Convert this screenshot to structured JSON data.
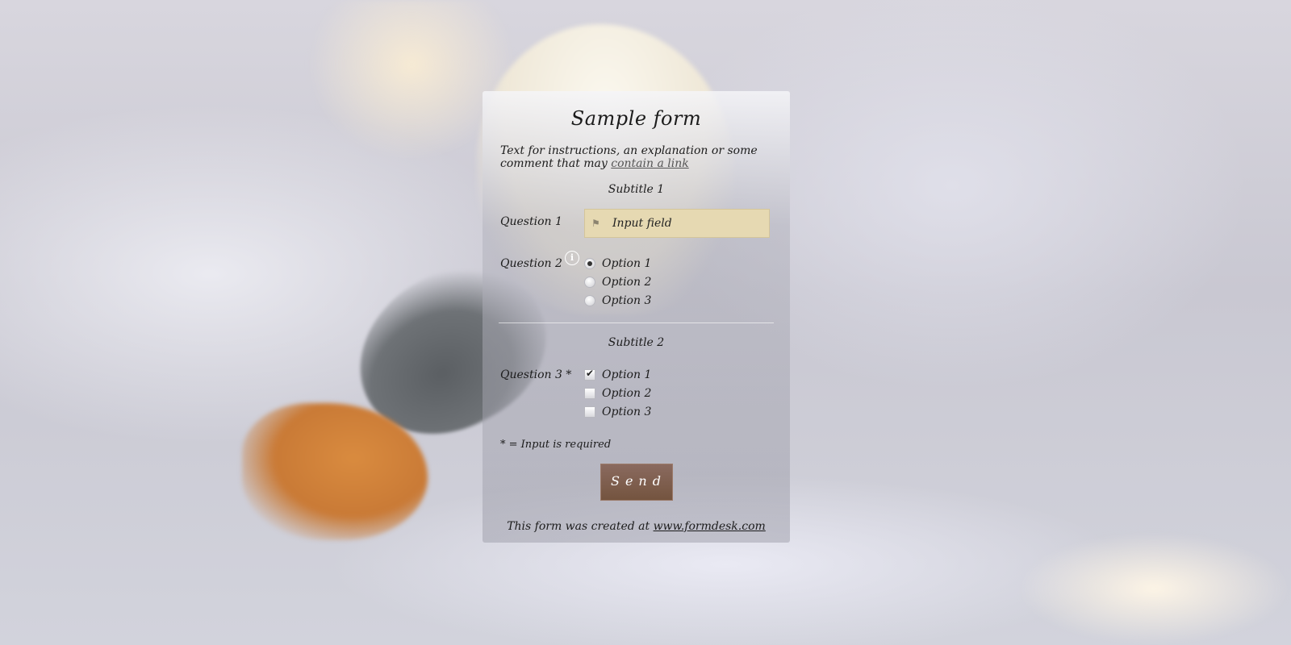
{
  "form": {
    "title": "Sample form",
    "intro_text": "Text for instructions, an explanation or some comment that may ",
    "intro_link": "contain a link",
    "subtitle1": "Subtitle 1",
    "question1": {
      "label": "Question 1",
      "input_value": "Input field",
      "icon": "tag-icon"
    },
    "question2": {
      "label": "Question 2",
      "info_icon": "i",
      "options": [
        "Option 1",
        "Option 2",
        "Option 3"
      ],
      "selected": "Option 1"
    },
    "subtitle2": "Subtitle 2",
    "question3": {
      "label": "Question 3 *",
      "options": [
        "Option 1",
        "Option 2",
        "Option 3"
      ],
      "checked": [
        "Option 1"
      ]
    },
    "required_note": "* = Input is required",
    "send_label": "Send",
    "footer_text": "This form was created at ",
    "footer_link": "www.formdesk.com"
  },
  "colors": {
    "input_bg": "#e6d9b2",
    "send_bg": "#7c5c4c"
  }
}
